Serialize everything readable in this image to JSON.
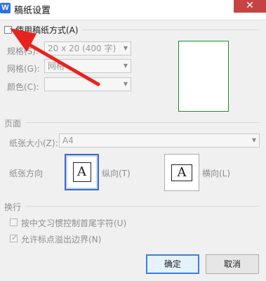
{
  "window": {
    "app_icon_label": "W",
    "title": "稿纸设置",
    "close_glyph": "✕"
  },
  "use_grid": {
    "label": "使用稿纸方式(A)",
    "checked": false
  },
  "grid_settings": {
    "spec_label": "规格(S):",
    "spec_value": "20 x 20 (400 字)",
    "grid_label": "网格(G):",
    "grid_value": "网格",
    "color_label": "颜色(C):",
    "color_value": ""
  },
  "page": {
    "section_title": "页面",
    "paper_size_label": "纸张大小(Z):",
    "paper_size_value": "A4",
    "orientation_label": "纸张方向",
    "portrait_glyph": "A",
    "portrait_label": "纵向(T)",
    "landscape_glyph": "A",
    "landscape_label": "横向(L)",
    "selected_orientation": "portrait"
  },
  "wrap": {
    "section_title": "换行",
    "option1_label": "按中文习惯控制首尾字符(U)",
    "option1_checked": false,
    "option2_label": "允许标点溢出边界(N)",
    "option2_checked": true,
    "check_glyph": "✓"
  },
  "buttons": {
    "ok": "确定",
    "cancel": "取消"
  },
  "icons": {
    "dropdown": "chevron-down-icon",
    "annotation": "red-arrow-pointer"
  },
  "colors": {
    "preview_border": "#1d8a2a",
    "annotation_arrow": "#e8231f",
    "close_button": "#c74343",
    "primary_button_border": "#3c7fd8"
  }
}
